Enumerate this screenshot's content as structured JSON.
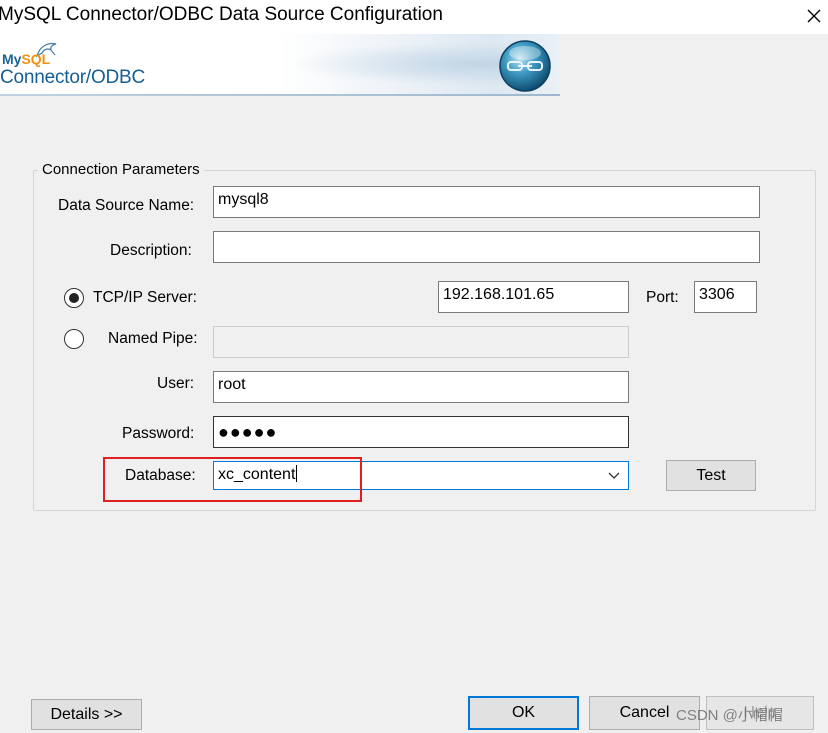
{
  "window": {
    "title": "MySQL Connector/ODBC Data Source Configuration",
    "close_icon": "close-icon"
  },
  "banner": {
    "logo_my": "My",
    "logo_sql": "SQL",
    "logo_product": "Connector/ODBC",
    "orb_icon": "connector-orb-icon"
  },
  "group": {
    "legend": "Connection Parameters"
  },
  "fields": {
    "dsn_label": "Data Source Name:",
    "dsn_value": "mysql8",
    "description_label": "Description:",
    "description_value": "",
    "tcpip_label": "TCP/IP Server:",
    "tcpip_selected": true,
    "server_value": "192.168.101.65",
    "port_label": "Port:",
    "port_value": "3306",
    "named_pipe_label": "Named Pipe:",
    "named_pipe_value": "",
    "user_label": "User:",
    "user_value": "root",
    "password_label": "Password:",
    "password_value": "●●●●●",
    "database_label": "Database:",
    "database_value": "xc_content"
  },
  "buttons": {
    "test": "Test",
    "details": "Details >>",
    "ok": "OK",
    "cancel": "Cancel",
    "help": "Help"
  },
  "watermark": "CSDN @小帽帽",
  "colors": {
    "accent": "#0078d7",
    "highlight": "#e02020",
    "logo_blue": "#155f93",
    "logo_orange": "#f29111"
  }
}
